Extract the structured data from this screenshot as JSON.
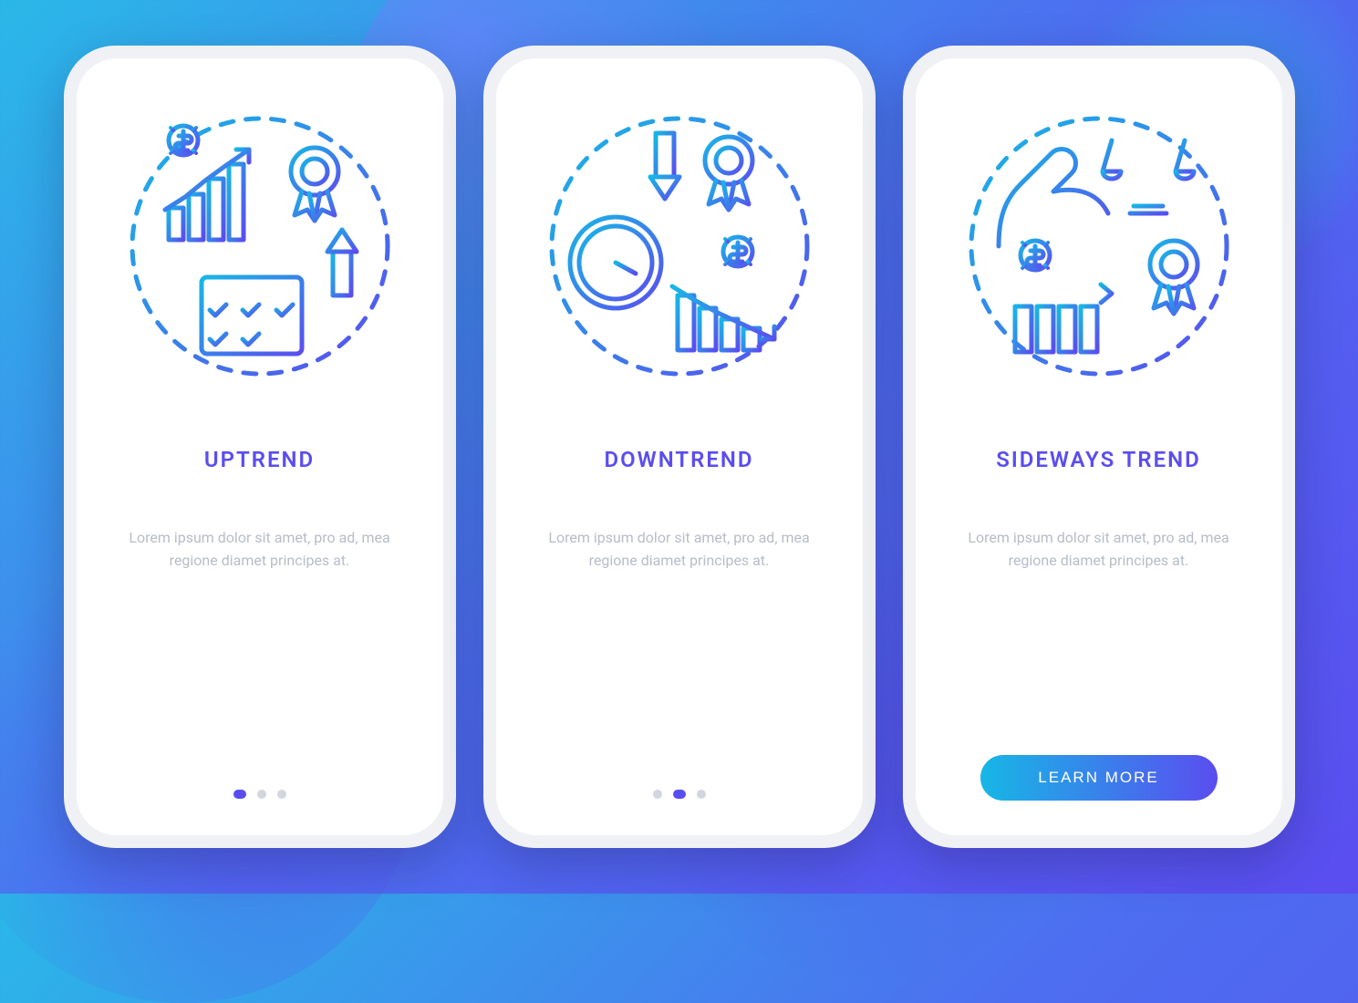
{
  "screens": [
    {
      "title": "UPTREND",
      "description": "Lorem ipsum dolor sit amet, pro ad, mea regione diamet principes at.",
      "active_dot": 0,
      "illustration": "uptrend"
    },
    {
      "title": "DOWNTREND",
      "description": "Lorem ipsum dolor sit amet, pro ad, mea regione diamet principes at.",
      "active_dot": 1,
      "illustration": "downtrend"
    },
    {
      "title": "SIDEWAYS TREND",
      "description": "Lorem ipsum dolor sit amet, pro ad, mea regione diamet principes at.",
      "cta": "LEARN MORE",
      "illustration": "sideways"
    }
  ],
  "colors": {
    "accent": "#5a4df0",
    "accent_light": "#17b7e6",
    "text_muted": "#b7bcc8",
    "dot_inactive": "#d3d6de"
  },
  "icons": {
    "uptrend": [
      "bar-chart-up-icon",
      "dollar-gear-icon",
      "award-badge-icon",
      "arrow-up-icon",
      "calendar-check-icon"
    ],
    "downtrend": [
      "arrow-down-icon",
      "award-badge-icon",
      "clock-icon",
      "dollar-gear-icon",
      "bar-chart-down-icon"
    ],
    "sideways": [
      "hand-icon",
      "scales-icon",
      "dollar-gear-icon",
      "bar-chart-flat-icon",
      "award-badge-icon"
    ]
  }
}
